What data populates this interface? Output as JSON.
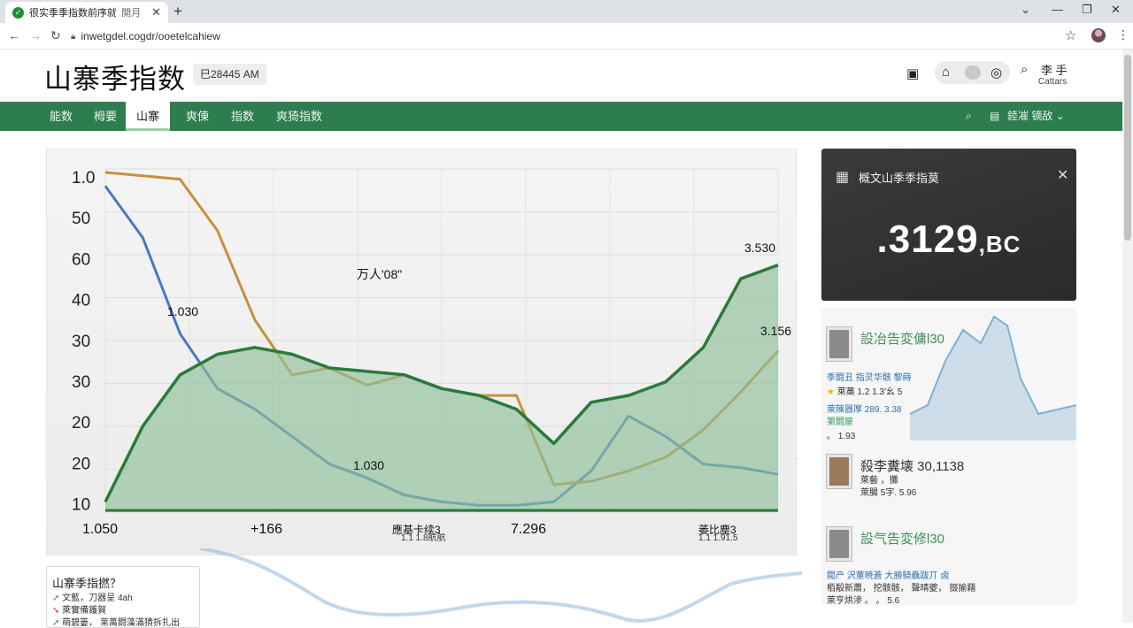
{
  "browser": {
    "tab_title": "很实季季指数前序就辑",
    "tab_subtitle": "開月",
    "url": "inwetgdel.cogdr/ooetelcahiew"
  },
  "header": {
    "title": "山寨季指数",
    "time": "巳28445 AM",
    "user_name": "李 手",
    "user_sub": "Cattars"
  },
  "nav": {
    "items": [
      {
        "label": "能数"
      },
      {
        "label": "栂要"
      },
      {
        "label": "山寨"
      },
      {
        "label": "爽倲"
      },
      {
        "label": "指数"
      },
      {
        "label": "爽猗指数"
      }
    ],
    "active_index": 2,
    "right_label": "錴凗 镝敌"
  },
  "chart_data": {
    "type": "line",
    "y_tick_labels": [
      "1.0",
      "50",
      "60",
      "40",
      "30",
      "30",
      "20",
      "20",
      "10"
    ],
    "annotations": [
      "1.030",
      "1.030",
      "万人'08\"",
      "3.530",
      "3.156"
    ],
    "x_tick_labels": [
      "1.050",
      "+166",
      "應基卡续3",
      "7.296",
      "萎比塵3"
    ],
    "x_tick_sublabels": [
      "1.1 1.8航航",
      "1.1 1.91.5"
    ],
    "series": [
      {
        "values": [
          0.95,
          0.8,
          0.52,
          0.36,
          0.3,
          0.22,
          0.14,
          0.1,
          0.05,
          0.03,
          0.02,
          0.02,
          0.03,
          0.12,
          0.28,
          0.22,
          0.14,
          0.13,
          0.11
        ],
        "color": "#4a78c2"
      },
      {
        "values": [
          0.99,
          0.98,
          0.97,
          0.82,
          0.56,
          0.4,
          0.42,
          0.37,
          0.4,
          0.36,
          0.34,
          0.34,
          0.08,
          0.09,
          0.12,
          0.16,
          0.24,
          0.35,
          0.47
        ],
        "color": "#c8903a"
      },
      {
        "values": [
          0.03,
          0.25,
          0.4,
          0.46,
          0.48,
          0.46,
          0.42,
          0.41,
          0.4,
          0.36,
          0.34,
          0.3,
          0.2,
          0.32,
          0.34,
          0.38,
          0.48,
          0.68,
          0.72
        ],
        "color": "#2a7a3a"
      }
    ],
    "grid": true
  },
  "side_card": {
    "title": "概文山季季指莫",
    "value": ".3129",
    "suffix": ",BC"
  },
  "side_list": [
    {
      "head": "設冶告変傭l30",
      "lines": [
        "季闘丑 指灵华骸 黎蒔",
        "萊藁 1.2 1.3'幺 5",
        "萊陳器厚 289. 3.38",
        "第闘屋",
        "。 1.93"
      ],
      "star": "★"
    },
    {
      "head": "殺李糞壊 30,1138",
      "lines": [
        "萊藝 ，攤",
        "萊腸 5字. 5.96"
      ]
    },
    {
      "head": "設气告変修l30",
      "lines": [
        "閥产 沢董暁蒼 大勝騎驫跋丌 卤",
        "栢殽新蕭， 挖骸骸， 聲晴夔， 掇揄藉",
        "萊亨烘滲 。 。 5.6"
      ]
    }
  ],
  "mini_card": {
    "title": "山寨季指撚？",
    "lines": [
      "文藍，刀器呈 4ah",
      "萊實備鑊賀",
      "萌碧篓， 莱萬闘藻滿猜拆扎出"
    ]
  },
  "colors": {
    "nav_green": "#2e7d4f",
    "series_blue": "#4a78c2",
    "series_orange": "#c8903a",
    "series_green": "#2a7a3a",
    "area_fill": "#8ebf98"
  }
}
